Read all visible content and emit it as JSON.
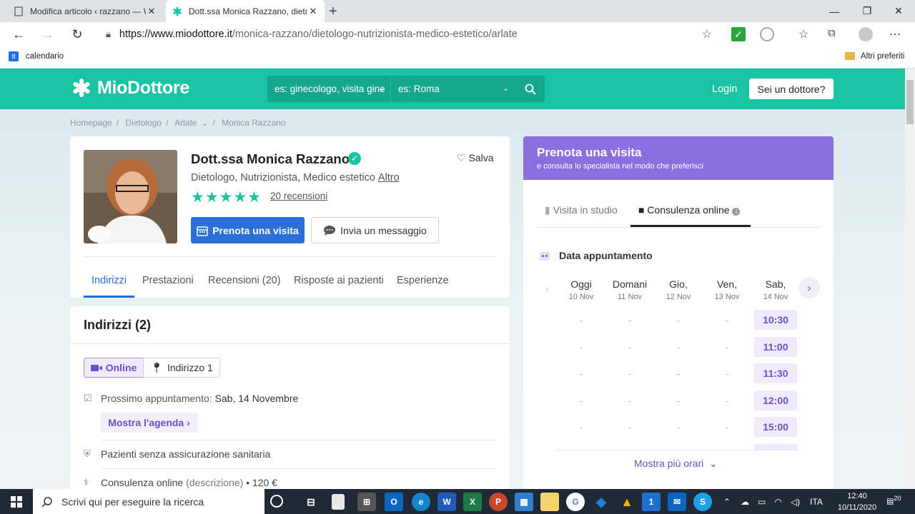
{
  "browser": {
    "tabs": [
      {
        "title": "Modifica articolo ‹ razzano — W"
      },
      {
        "title": "Dott.ssa Monica Razzano, dietolo"
      }
    ],
    "url_domain": "https://www.miodottore.it",
    "url_path": "/monica-razzano/dietologo-nutrizionista-medico-estetico/arlate",
    "bookmarks": {
      "left": "calendario",
      "right": "Altri preferiti"
    }
  },
  "site": {
    "logo": "MioDottore",
    "search_specialty": "es: ginecologo, visita gine",
    "search_city": "es: Roma",
    "login": "Login",
    "doctor_button": "Sei un dottore?"
  },
  "breadcrumb": [
    "Homepage",
    "Dietologo",
    "Arlate",
    "Monica Razzano"
  ],
  "profile": {
    "name": "Dott.ssa Monica Razzano",
    "save": "Salva",
    "specialties": "Dietologo, Nutrizionista, Medico estetico",
    "more": "Altro",
    "stars": "★★★★★",
    "rating": 5,
    "reviews": "20 recensioni",
    "book_button": "Prenota una visita",
    "message_button": "Invia un messaggio",
    "tabs": [
      "Indirizzi",
      "Prestazioni",
      "Recensioni (20)",
      "Risposte ai pazienti",
      "Esperienze"
    ]
  },
  "addresses": {
    "title": "Indirizzi (2)",
    "seg_online": "Online",
    "seg_address": "Indirizzo 1",
    "next_label": "Prossimo appuntamento:",
    "next_value": "Sab, 14 Novembre",
    "agenda_button": "Mostra l'agenda",
    "insurance": "Pazienti senza assicurazione sanitaria",
    "consult_label": "Consulenza online",
    "consult_desc": "(descrizione)",
    "consult_price": "• 120 €"
  },
  "booking": {
    "title": "Prenota una visita",
    "subtitle": "e consulta lo specialista nel modo che preferisci",
    "tab_studio": "Visita in studio",
    "tab_online": "Consulenza online",
    "date_header": "Data appuntamento",
    "days": [
      {
        "day": "Oggi",
        "date": "10 Nov"
      },
      {
        "day": "Domani",
        "date": "11 Nov"
      },
      {
        "day": "Gio,",
        "date": "12 Nov"
      },
      {
        "day": "Ven,",
        "date": "13 Nov"
      },
      {
        "day": "Sab,",
        "date": "14 Nov"
      }
    ],
    "dash": "-",
    "slots": [
      "10:30",
      "11:00",
      "11:30",
      "12:00",
      "15:00"
    ],
    "more_times": "Mostra più orari"
  },
  "taskbar": {
    "search": "Scrivi qui per eseguire la ricerca",
    "lang": "ITA",
    "time": "12:40",
    "date": "10/11/2020",
    "notifications": "20"
  },
  "colors": {
    "brand": "#19c3a4",
    "primary_blue": "#2a6fd6",
    "purple": "#8b6fe0"
  }
}
